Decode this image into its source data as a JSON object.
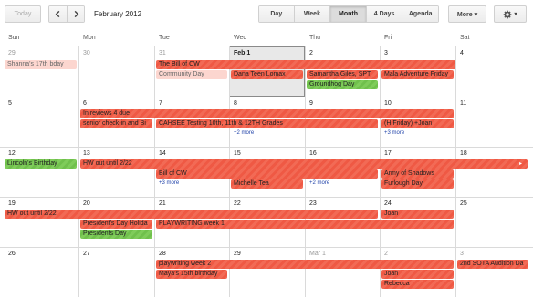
{
  "toolbar": {
    "today_label": "Today",
    "date_range": "February 2012",
    "views": [
      "Day",
      "Week",
      "Month",
      "4 Days",
      "Agenda"
    ],
    "active_view": "Month",
    "more_label": "More ▾",
    "settings_caret": "▾"
  },
  "weekdays": [
    "Sun",
    "Mon",
    "Tue",
    "Wed",
    "Thu",
    "Fri",
    "Sat"
  ],
  "weeks": [
    [
      "29",
      "30",
      "31",
      "Feb 1",
      "2",
      "3",
      "4"
    ],
    [
      "5",
      "6",
      "7",
      "8",
      "9",
      "10",
      "11"
    ],
    [
      "12",
      "13",
      "14",
      "15",
      "16",
      "17",
      "18"
    ],
    [
      "19",
      "20",
      "21",
      "22",
      "23",
      "24",
      "25"
    ],
    [
      "26",
      "27",
      "28",
      "29",
      "Mar 1",
      "2",
      "3"
    ]
  ],
  "events": {
    "w0": [
      "Shanna's 17th bday",
      "The Bill of CW",
      "Community Day",
      "Dana Teen Lomax",
      "Samantha Giles, SPT",
      "Mala Adventure Friday",
      "Groundhog Day"
    ],
    "w1": [
      "In reviews 4 due",
      "senior check-in and Bi",
      "CAHSEE Testing 10th, 11th & 12TH Grades",
      "(H Friday) +Joan",
      "+2 more",
      "+3 more"
    ],
    "w2": [
      "Lincoln's Birthday",
      "HW out until 2/22",
      "Bill of CW",
      "+3 more",
      "Michelle Tea",
      "+2 more",
      "Army of Shadows",
      "Furlough Day"
    ],
    "w3": [
      "HW out until 2/22",
      "Joan",
      "President's Day Holida",
      "PLAYWRITING week 1",
      "Presidents Day"
    ],
    "w4": [
      "playwriting week 2",
      "Maya's 15th birthday",
      "Joan",
      "Rebecca",
      "2nd SOTA Audition Da"
    ]
  },
  "colors": {
    "event_red": "#f26a55",
    "event_green": "#7fcc5a",
    "event_pink": "#fcd6cf",
    "today_bg": "#e8e8e8"
  }
}
